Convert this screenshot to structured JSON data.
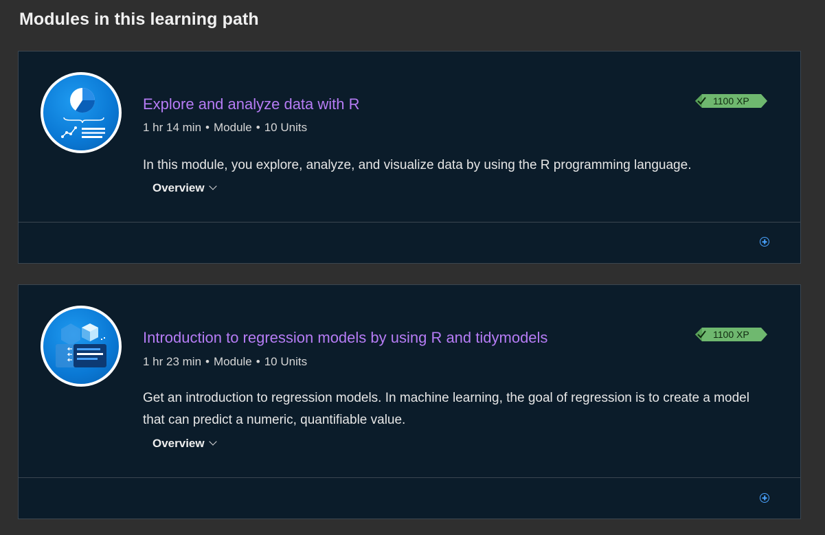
{
  "section": {
    "title": "Modules in this learning path"
  },
  "modules": [
    {
      "title": "Explore and analyze data with R",
      "duration": "1 hr 14 min",
      "type": "Module",
      "units": "10 Units",
      "description": "In this module, you explore, analyze, and visualize data by using the R programming language.",
      "overview_label": "Overview",
      "xp": "1100 XP",
      "icon": "data-analysis-icon"
    },
    {
      "title": "Introduction to regression models by using R and tidymodels",
      "duration": "1 hr 23 min",
      "type": "Module",
      "units": "10 Units",
      "description": "Get an introduction to regression models. In machine learning, the goal of regression is to create a model that can predict a numeric, quantifiable value.",
      "overview_label": "Overview",
      "xp": "1100 XP",
      "icon": "regression-model-icon"
    }
  ],
  "meta_separator": "•",
  "colors": {
    "page_bg": "#2f2f2f",
    "card_bg": "#0b1c2a",
    "title_link": "#b67cf5",
    "xp_badge": "#6fb86f",
    "accent": "#4aa3ff"
  }
}
